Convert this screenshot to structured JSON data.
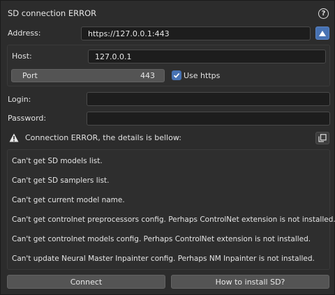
{
  "window": {
    "title": "SD connection ERROR"
  },
  "icons": {
    "help": "question-circle-icon",
    "collapse": "triangle-up-icon",
    "warning": "warning-triangle-icon",
    "copy": "copy-icon",
    "check": "checkmark-icon"
  },
  "address": {
    "label": "Address:",
    "value": "https://127.0.0.1:443"
  },
  "host": {
    "label": "Host:",
    "value": "127.0.0.1"
  },
  "port": {
    "label": "Port",
    "value": "443"
  },
  "use_https": {
    "label": "Use https",
    "checked": true
  },
  "login": {
    "label": "Login:",
    "value": ""
  },
  "password": {
    "label": "Password:",
    "value": ""
  },
  "error": {
    "header": "Connection ERROR, the details is bellow:",
    "lines": [
      "Can't get SD models list.",
      "Can't get SD samplers list.",
      "Can't get current model name.",
      "Can't get controlnet preprocessors config. Perhaps ControlNet extension is not installed.",
      "Can't get controlnet models config. Perhaps ControlNet extension is not installed.",
      "Can't update Neural Master Inpainter config. Perhaps NM Inpainter  is not installed."
    ]
  },
  "buttons": {
    "connect": "Connect",
    "install": "How to install SD?"
  },
  "colors": {
    "accent": "#4772b3",
    "background": "#2c2c2c",
    "field": "#1d1d1d",
    "button": "#545454"
  }
}
